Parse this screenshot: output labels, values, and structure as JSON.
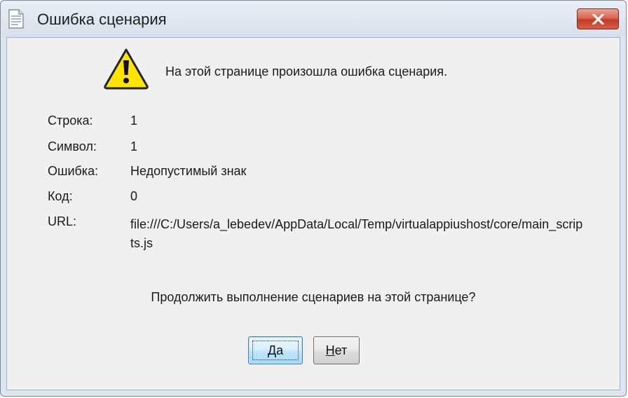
{
  "window": {
    "title": "Ошибка сценария"
  },
  "dialog": {
    "message": "На этой странице произошла ошибка сценария.",
    "fields": [
      {
        "label": "Строка:",
        "value": "1"
      },
      {
        "label": "Символ:",
        "value": "1"
      },
      {
        "label": "Ошибка:",
        "value": "Недопустимый знак"
      },
      {
        "label": "Код:",
        "value": "0"
      },
      {
        "label": "URL:",
        "value": "file:///C:/Users/a_lebedev/AppData/Local/Temp/virtualappiushost/core/main_scripts.js"
      }
    ],
    "question": "Продолжить выполнение сценариев на этой странице?",
    "buttons": {
      "yes_mnemonic": "Д",
      "yes_rest": "а",
      "no_mnemonic": "Н",
      "no_rest": "ет"
    }
  },
  "icons": {
    "app": "document-icon",
    "close": "close-icon",
    "warning": "warning-icon"
  },
  "colors": {
    "close_button": "#c53a26",
    "warning_fill": "#ffe400",
    "client_bg": "#f0f0f0",
    "frame_bg": "#dde6f0"
  }
}
